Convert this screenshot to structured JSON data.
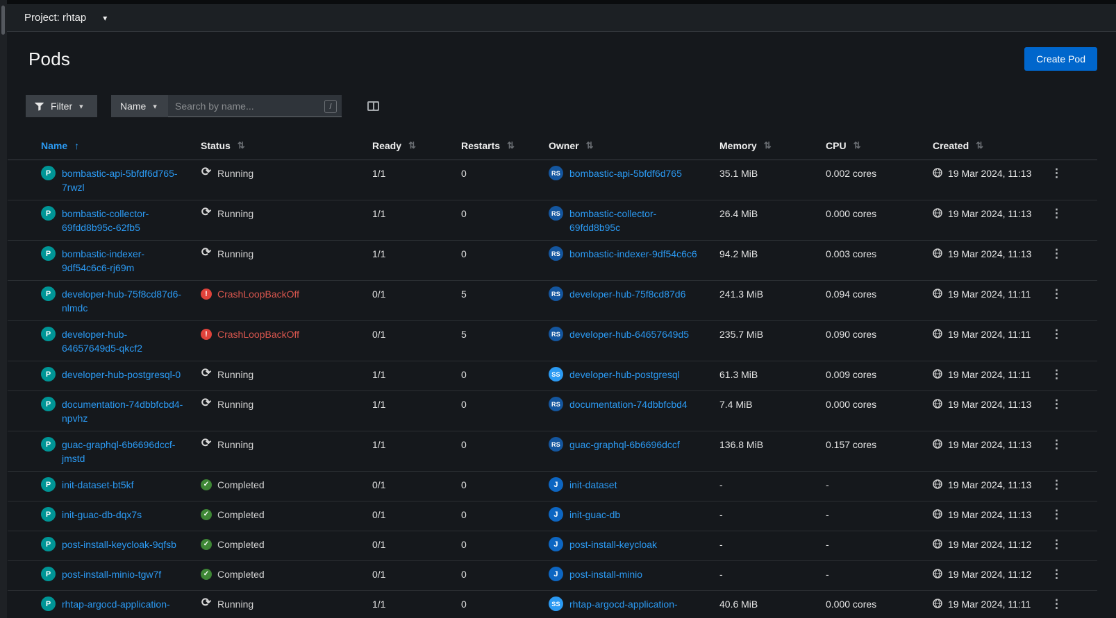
{
  "project_bar": {
    "label": "Project: rhtap"
  },
  "page": {
    "title": "Pods",
    "create_button_label": "Create Pod"
  },
  "toolbar": {
    "filter_label": "Filter",
    "attribute_label": "Name",
    "search_placeholder": "Search by name...",
    "shortcut_key": "/"
  },
  "badges": {
    "pod": "P"
  },
  "icons": {
    "caret": "▾",
    "sort": "⇅",
    "sort_asc": "↑",
    "kebab": "⋮"
  },
  "status_glyphs": {
    "running": "⟳",
    "completed": "✓",
    "crash": "!"
  },
  "colors": {
    "accent_blue": "#0066cc",
    "link_blue": "#2b9af3",
    "badge_pod_teal": "#009596",
    "badge_replicaset_blue": "#14569f",
    "badge_statefulset_blue": "#2b9af3",
    "badge_job_blue": "#0d66c2",
    "status_running_gray": "#d2d2d2",
    "status_completed_green": "#3e8635",
    "status_crash_red": "#e0433b"
  },
  "table": {
    "columns": [
      "Name",
      "Status",
      "Ready",
      "Restarts",
      "Owner",
      "Memory",
      "CPU",
      "Created"
    ],
    "sorted_column": "Name",
    "sort_direction": "ascending",
    "rows": [
      {
        "name": "bombastic-api-5bfdf6d765-7rwzl",
        "status": "Running",
        "status_kind": "running",
        "ready": "1/1",
        "restarts": "0",
        "owner": {
          "badge": "RS",
          "name": "bombastic-api-5bfdf6d765"
        },
        "memory": "35.1 MiB",
        "cpu": "0.002 cores",
        "created": "19 Mar 2024, 11:13"
      },
      {
        "name": "bombastic-collector-69fdd8b95c-62fb5",
        "status": "Running",
        "status_kind": "running",
        "ready": "1/1",
        "restarts": "0",
        "owner": {
          "badge": "RS",
          "name": "bombastic-collector-69fdd8b95c"
        },
        "memory": "26.4 MiB",
        "cpu": "0.000 cores",
        "created": "19 Mar 2024, 11:13"
      },
      {
        "name": "bombastic-indexer-9df54c6c6-rj69m",
        "status": "Running",
        "status_kind": "running",
        "ready": "1/1",
        "restarts": "0",
        "owner": {
          "badge": "RS",
          "name": "bombastic-indexer-9df54c6c6"
        },
        "memory": "94.2 MiB",
        "cpu": "0.003 cores",
        "created": "19 Mar 2024, 11:13"
      },
      {
        "name": "developer-hub-75f8cd87d6-nlmdc",
        "status": "CrashLoopBackOff",
        "status_kind": "crash",
        "ready": "0/1",
        "restarts": "5",
        "owner": {
          "badge": "RS",
          "name": "developer-hub-75f8cd87d6"
        },
        "memory": "241.3 MiB",
        "cpu": "0.094 cores",
        "created": "19 Mar 2024, 11:11"
      },
      {
        "name": "developer-hub-64657649d5-qkcf2",
        "status": "CrashLoopBackOff",
        "status_kind": "crash",
        "ready": "0/1",
        "restarts": "5",
        "owner": {
          "badge": "RS",
          "name": "developer-hub-64657649d5"
        },
        "memory": "235.7 MiB",
        "cpu": "0.090 cores",
        "created": "19 Mar 2024, 11:11"
      },
      {
        "name": "developer-hub-postgresql-0",
        "status": "Running",
        "status_kind": "running",
        "ready": "1/1",
        "restarts": "0",
        "owner": {
          "badge": "SS",
          "name": "developer-hub-postgresql"
        },
        "memory": "61.3 MiB",
        "cpu": "0.009 cores",
        "created": "19 Mar 2024, 11:11"
      },
      {
        "name": "documentation-74dbbfcbd4-npvhz",
        "status": "Running",
        "status_kind": "running",
        "ready": "1/1",
        "restarts": "0",
        "owner": {
          "badge": "RS",
          "name": "documentation-74dbbfcbd4"
        },
        "memory": "7.4 MiB",
        "cpu": "0.000 cores",
        "created": "19 Mar 2024, 11:13"
      },
      {
        "name": "guac-graphql-6b6696dccf-jmstd",
        "status": "Running",
        "status_kind": "running",
        "ready": "1/1",
        "restarts": "0",
        "owner": {
          "badge": "RS",
          "name": "guac-graphql-6b6696dccf"
        },
        "memory": "136.8 MiB",
        "cpu": "0.157 cores",
        "created": "19 Mar 2024, 11:13"
      },
      {
        "name": "init-dataset-bt5kf",
        "status": "Completed",
        "status_kind": "completed",
        "ready": "0/1",
        "restarts": "0",
        "owner": {
          "badge": "J",
          "name": "init-dataset"
        },
        "memory": "-",
        "cpu": "-",
        "created": "19 Mar 2024, 11:13"
      },
      {
        "name": "init-guac-db-dqx7s",
        "status": "Completed",
        "status_kind": "completed",
        "ready": "0/1",
        "restarts": "0",
        "owner": {
          "badge": "J",
          "name": "init-guac-db"
        },
        "memory": "-",
        "cpu": "-",
        "created": "19 Mar 2024, 11:13"
      },
      {
        "name": "post-install-keycloak-9qfsb",
        "status": "Completed",
        "status_kind": "completed",
        "ready": "0/1",
        "restarts": "0",
        "owner": {
          "badge": "J",
          "name": "post-install-keycloak"
        },
        "memory": "-",
        "cpu": "-",
        "created": "19 Mar 2024, 11:12"
      },
      {
        "name": "post-install-minio-tgw7f",
        "status": "Completed",
        "status_kind": "completed",
        "ready": "0/1",
        "restarts": "0",
        "owner": {
          "badge": "J",
          "name": "post-install-minio"
        },
        "memory": "-",
        "cpu": "-",
        "created": "19 Mar 2024, 11:12"
      },
      {
        "name": "rhtap-argocd-application-",
        "status": "Running",
        "status_kind": "running",
        "ready": "1/1",
        "restarts": "0",
        "owner": {
          "badge": "SS",
          "name": "rhtap-argocd-application-"
        },
        "memory": "40.6 MiB",
        "cpu": "0.000 cores",
        "created": "19 Mar 2024, 11:11"
      }
    ]
  }
}
